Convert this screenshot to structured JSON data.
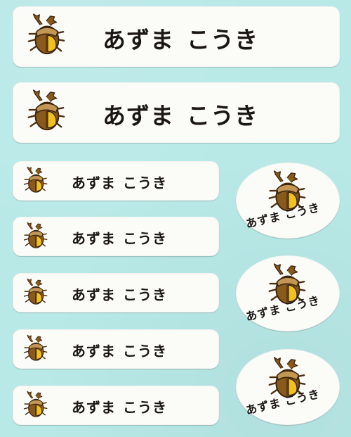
{
  "sticker_sheet": {
    "name_label": {
      "family_name": "あずま",
      "given_name": "こうき"
    },
    "icon": "stag-beetle-icon",
    "colors": {
      "background": "#b8e9e7",
      "label": "#fbfbf8",
      "text": "#1b1715",
      "beetle_body": "#8a5a1d",
      "beetle_shell": "#f1c21d",
      "beetle_head": "#c39654"
    }
  }
}
